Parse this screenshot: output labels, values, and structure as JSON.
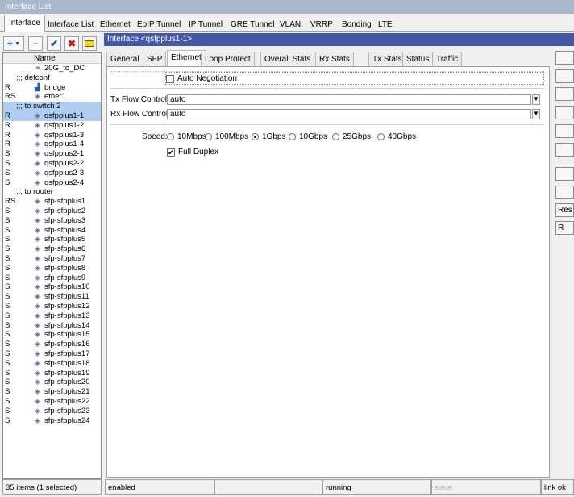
{
  "window": {
    "title": "Interface List"
  },
  "top_tabs": [
    "Interface",
    "Interface List",
    "Ethernet",
    "EoIP Tunnel",
    "IP Tunnel",
    "GRE Tunnel",
    "VLAN",
    "VRRP",
    "Bonding",
    "LTE"
  ],
  "toolbar": {
    "add": "+",
    "remove": "−",
    "enable": "✔",
    "disable": "✖"
  },
  "list": {
    "column_name": "Name",
    "rows": [
      {
        "flag": "",
        "name": "20G_to_DC",
        "type": "bonding",
        "group": false,
        "selected": false
      },
      {
        "flag": "",
        "name": ";;; defconf",
        "type": "",
        "group": true,
        "selected": false
      },
      {
        "flag": "R",
        "name": "bridge",
        "type": "bridge",
        "group": false,
        "selected": false
      },
      {
        "flag": "RS",
        "name": "ether1",
        "type": "eth",
        "group": false,
        "selected": false
      },
      {
        "flag": "",
        "name": ";;; to switch 2",
        "type": "",
        "group": true,
        "selected": true
      },
      {
        "flag": "R",
        "name": "qsfpplus1-1",
        "type": "eth",
        "group": false,
        "selected": true
      },
      {
        "flag": "R",
        "name": "qsfpplus1-2",
        "type": "eth",
        "group": false,
        "selected": false
      },
      {
        "flag": "R",
        "name": "qsfpplus1-3",
        "type": "eth",
        "group": false,
        "selected": false
      },
      {
        "flag": "R",
        "name": "qsfpplus1-4",
        "type": "eth",
        "group": false,
        "selected": false
      },
      {
        "flag": "S",
        "name": "qsfpplus2-1",
        "type": "eth",
        "group": false,
        "selected": false
      },
      {
        "flag": "S",
        "name": "qsfpplus2-2",
        "type": "eth",
        "group": false,
        "selected": false
      },
      {
        "flag": "S",
        "name": "qsfpplus2-3",
        "type": "eth",
        "group": false,
        "selected": false
      },
      {
        "flag": "S",
        "name": "qsfpplus2-4",
        "type": "eth",
        "group": false,
        "selected": false
      },
      {
        "flag": "",
        "name": ";;; to router",
        "type": "",
        "group": true,
        "selected": false
      },
      {
        "flag": "RS",
        "name": "sfp-sfpplus1",
        "type": "eth",
        "group": false,
        "selected": false
      },
      {
        "flag": "S",
        "name": "sfp-sfpplus2",
        "type": "eth",
        "group": false,
        "selected": false
      },
      {
        "flag": "S",
        "name": "sfp-sfpplus3",
        "type": "eth",
        "group": false,
        "selected": false
      },
      {
        "flag": "S",
        "name": "sfp-sfpplus4",
        "type": "eth",
        "group": false,
        "selected": false
      },
      {
        "flag": "S",
        "name": "sfp-sfpplus5",
        "type": "eth",
        "group": false,
        "selected": false
      },
      {
        "flag": "S",
        "name": "sfp-sfpplus6",
        "type": "eth",
        "group": false,
        "selected": false
      },
      {
        "flag": "S",
        "name": "sfp-sfpplus7",
        "type": "eth",
        "group": false,
        "selected": false
      },
      {
        "flag": "S",
        "name": "sfp-sfpplus8",
        "type": "eth",
        "group": false,
        "selected": false
      },
      {
        "flag": "S",
        "name": "sfp-sfpplus9",
        "type": "eth",
        "group": false,
        "selected": false
      },
      {
        "flag": "S",
        "name": "sfp-sfpplus10",
        "type": "eth",
        "group": false,
        "selected": false
      },
      {
        "flag": "S",
        "name": "sfp-sfpplus11",
        "type": "eth",
        "group": false,
        "selected": false
      },
      {
        "flag": "S",
        "name": "sfp-sfpplus12",
        "type": "eth",
        "group": false,
        "selected": false
      },
      {
        "flag": "S",
        "name": "sfp-sfpplus13",
        "type": "eth",
        "group": false,
        "selected": false
      },
      {
        "flag": "S",
        "name": "sfp-sfpplus14",
        "type": "eth",
        "group": false,
        "selected": false
      },
      {
        "flag": "S",
        "name": "sfp-sfpplus15",
        "type": "eth",
        "group": false,
        "selected": false
      },
      {
        "flag": "S",
        "name": "sfp-sfpplus16",
        "type": "eth",
        "group": false,
        "selected": false
      },
      {
        "flag": "S",
        "name": "sfp-sfpplus17",
        "type": "eth",
        "group": false,
        "selected": false
      },
      {
        "flag": "S",
        "name": "sfp-sfpplus18",
        "type": "eth",
        "group": false,
        "selected": false
      },
      {
        "flag": "S",
        "name": "sfp-sfpplus19",
        "type": "eth",
        "group": false,
        "selected": false
      },
      {
        "flag": "S",
        "name": "sfp-sfpplus20",
        "type": "eth",
        "group": false,
        "selected": false
      },
      {
        "flag": "S",
        "name": "sfp-sfpplus21",
        "type": "eth",
        "group": false,
        "selected": false
      },
      {
        "flag": "S",
        "name": "sfp-sfpplus22",
        "type": "eth",
        "group": false,
        "selected": false
      },
      {
        "flag": "S",
        "name": "sfp-sfpplus23",
        "type": "eth",
        "group": false,
        "selected": false
      },
      {
        "flag": "S",
        "name": "sfp-sfpplus24",
        "type": "eth",
        "group": false,
        "selected": false
      }
    ],
    "status": "35 items (1 selected)"
  },
  "dialog": {
    "title": "Interface <qsfpplus1-1>",
    "tabs": [
      "General",
      "SFP",
      "Ethernet",
      "Loop Protect",
      "Overall Stats",
      "Rx Stats",
      "Tx Stats",
      "Status",
      "Traffic"
    ],
    "active_tab": "Ethernet",
    "auto_negotiation_label": "Auto Negotiation",
    "auto_negotiation": false,
    "tx_flow_label": "Tx Flow Control:",
    "tx_flow_value": "auto",
    "rx_flow_label": "Rx Flow Control:",
    "rx_flow_value": "auto",
    "speed_label": "Speed:",
    "speeds": [
      "10Mbps",
      "100Mbps",
      "1Gbps",
      "10Gbps",
      "25Gbps",
      "40Gbps"
    ],
    "speed_selected": "1Gbps",
    "full_duplex_label": "Full Duplex",
    "full_duplex": true,
    "right_buttons": [
      "",
      "",
      "",
      "",
      "",
      "",
      "",
      "",
      "Res",
      "R"
    ],
    "status": {
      "enabled": "enabled",
      "field2": "",
      "field3": "",
      "running": "running",
      "slave": "slave",
      "link": "link ok"
    }
  },
  "colors": {
    "dialog_title_bg": "#4557a6",
    "window_title_bg": "#a9b8cc",
    "selected_row": "#aecdf0"
  }
}
